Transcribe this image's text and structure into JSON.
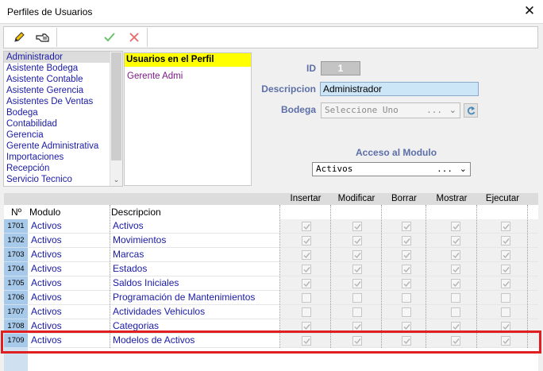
{
  "window": {
    "title": "Perfiles de Usuarios",
    "close_glyph": "✕"
  },
  "toolbar": {
    "icons": [
      "pencil-icon",
      "hand-pointer-icon",
      "check-icon",
      "x-icon"
    ]
  },
  "profiles": {
    "items": [
      {
        "label": "Administrador",
        "selected": true
      },
      {
        "label": "Asistente Bodega"
      },
      {
        "label": "Asistente Contable"
      },
      {
        "label": "Asistente Gerencia"
      },
      {
        "label": "Asistentes De Ventas"
      },
      {
        "label": "Bodega"
      },
      {
        "label": "Contabilidad"
      },
      {
        "label": "Gerencia"
      },
      {
        "label": "Gerente Administrativa"
      },
      {
        "label": "Importaciones"
      },
      {
        "label": "Recepción"
      },
      {
        "label": "Servicio Tecnico"
      }
    ],
    "scroll_arrow": "⌄"
  },
  "users": {
    "header": "Usuarios en el Perfil",
    "items": [
      "Gerente Admi"
    ]
  },
  "form": {
    "id_label": "ID",
    "id_value": "1",
    "descripcion_label": "Descripcion",
    "descripcion_value": "Administrador",
    "bodega_label": "Bodega",
    "bodega_value": "Seleccione Uno",
    "bodega_dots": "...",
    "acceso_label": "Acceso al Modulo",
    "modulo_value": "Activos",
    "modulo_dots": "..."
  },
  "grid": {
    "headers": {
      "num": "Nº",
      "modulo": "Modulo",
      "descripcion": "Descripcion",
      "perms": [
        "Insertar",
        "Modificar",
        "Borrar",
        "Mostrar",
        "Ejecutar"
      ]
    },
    "rows": [
      {
        "num": "1701",
        "modulo": "Activos",
        "descripcion": "Activos",
        "perms": [
          true,
          true,
          true,
          true,
          true
        ]
      },
      {
        "num": "1702",
        "modulo": "Activos",
        "descripcion": "Movimientos",
        "perms": [
          true,
          true,
          true,
          true,
          true
        ]
      },
      {
        "num": "1703",
        "modulo": "Activos",
        "descripcion": "Marcas",
        "perms": [
          true,
          true,
          true,
          true,
          true
        ]
      },
      {
        "num": "1704",
        "modulo": "Activos",
        "descripcion": "Estados",
        "perms": [
          true,
          true,
          true,
          true,
          true
        ]
      },
      {
        "num": "1705",
        "modulo": "Activos",
        "descripcion": "Saldos Iniciales",
        "perms": [
          true,
          true,
          true,
          true,
          true
        ]
      },
      {
        "num": "1706",
        "modulo": "Activos",
        "descripcion": "Programación de Mantenimientos",
        "perms": [
          false,
          false,
          false,
          false,
          false
        ]
      },
      {
        "num": "1707",
        "modulo": "Activos",
        "descripcion": "Actividades Vehiculos",
        "perms": [
          false,
          false,
          false,
          false,
          false
        ]
      },
      {
        "num": "1708",
        "modulo": "Activos",
        "descripcion": "Categorias",
        "perms": [
          true,
          true,
          true,
          true,
          true
        ]
      },
      {
        "num": "1709",
        "modulo": "Activos",
        "descripcion": "Modelos de Activos",
        "perms": [
          true,
          true,
          true,
          true,
          true
        ]
      }
    ]
  },
  "colors": {
    "highlight": "#e02020",
    "header_yellow": "#ffff00",
    "link_blue": "#1a1aa8",
    "label_blue": "#5c6fa8"
  }
}
